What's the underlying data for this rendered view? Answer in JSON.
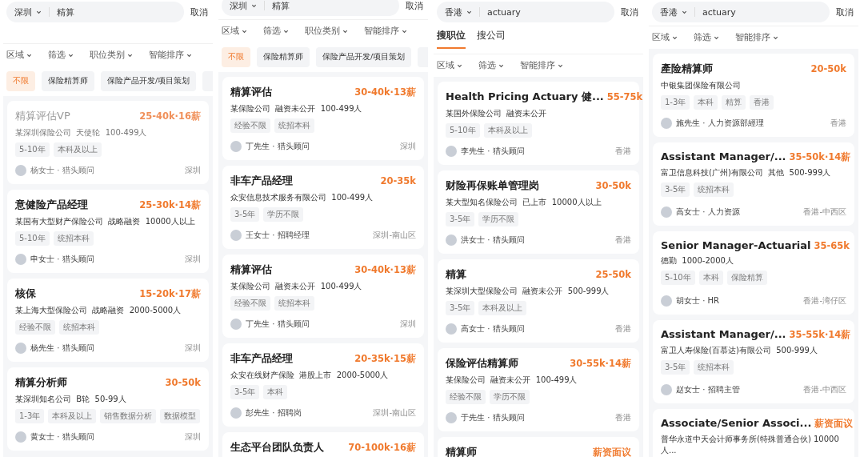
{
  "panels": [
    {
      "search": {
        "city": "深圳",
        "query": "精算"
      },
      "cancel": "取消",
      "filters": [
        "区域",
        "筛选",
        "职位类别",
        "智能排序"
      ],
      "chips": [
        {
          "label": "不限",
          "selected": true
        },
        {
          "label": "保险精算师",
          "selected": false
        },
        {
          "label": "保险产品开发/项目策划",
          "selected": false
        }
      ],
      "jobs": [
        {
          "title": "精算评估VP",
          "salary": "25-40k·16薪",
          "company": "某深圳保险公司  天使轮  100-499人",
          "tags": [
            "5-10年",
            "本科及以上"
          ],
          "recruiter": "杨女士 · 猎头顾问",
          "location": "深圳",
          "faded": true
        },
        {
          "title": "意健险产品经理",
          "salary": "25-30k·14薪",
          "company": "某国有大型财产保险公司  战略融资  10000人以上",
          "tags": [
            "5-10年",
            "统招本科"
          ],
          "recruiter": "申女士 · 猎头顾问",
          "location": "深圳",
          "faded": false
        },
        {
          "title": "核保",
          "salary": "15-20k·17薪",
          "company": "某上海大型保险公司  战略融资  2000-5000人",
          "tags": [
            "经验不限",
            "统招本科"
          ],
          "recruiter": "杨先生 · 猎头顾问",
          "location": "深圳",
          "faded": false
        },
        {
          "title": "精算分析师",
          "salary": "30-50k",
          "company": "某深圳知名公司  B轮  50-99人",
          "tags": [
            "1-3年",
            "本科及以上",
            "销售数据分析",
            "数据模型"
          ],
          "recruiter": "黄女士 · 猎头顾问",
          "location": "深圳",
          "faded": false
        }
      ]
    },
    {
      "search": {
        "city": "深圳",
        "query": "精算"
      },
      "cancel": "取消",
      "filters": [
        "区域",
        "筛选",
        "职位类别",
        "智能排序"
      ],
      "chips": [
        {
          "label": "不限",
          "selected": true
        },
        {
          "label": "保险精算师",
          "selected": false
        },
        {
          "label": "保险产品开发/项目策划",
          "selected": false
        }
      ],
      "jobs": [
        {
          "title": "精算评估",
          "salary": "30-40k·13薪",
          "company": "某保险公司  融资未公开  100-499人",
          "tags": [
            "经验不限",
            "统招本科"
          ],
          "recruiter": "丁先生 · 猎头顾问",
          "location": "深圳",
          "faded": false
        },
        {
          "title": "非车产品经理",
          "salary": "20-35k",
          "company": "众安信息技术服务有限公司  100-499人",
          "tags": [
            "3-5年",
            "学历不限"
          ],
          "recruiter": "王女士 · 招聘经理",
          "location": "深圳-南山区",
          "faded": false
        },
        {
          "title": "精算评估",
          "salary": "30-40k·13薪",
          "company": "某保险公司  融资未公开  100-499人",
          "tags": [
            "经验不限",
            "统招本科"
          ],
          "recruiter": "丁先生 · 猎头顾问",
          "location": "深圳",
          "faded": false
        },
        {
          "title": "非车产品经理",
          "salary": "20-35k·15薪",
          "company": "众安在线财产保险  港股上市  2000-5000人",
          "tags": [
            "3-5年",
            "本科"
          ],
          "recruiter": "彭先生 · 招聘岗",
          "location": "深圳-南山区",
          "faded": false
        },
        {
          "title": "生态平台团队负责人",
          "salary": "70-100k·16薪",
          "faded": false
        }
      ]
    },
    {
      "search": {
        "city": "香港",
        "query": "actuary"
      },
      "cancel": "取消",
      "tabs": [
        {
          "label": "搜职位",
          "selected": true
        },
        {
          "label": "搜公司",
          "selected": false
        }
      ],
      "filters": [
        "区域",
        "筛选",
        "智能排序"
      ],
      "jobs": [
        {
          "title": "Health Pricing Actuary 健...",
          "salary": "55-75k",
          "company": "某国外保险公司  融资未公开",
          "tags": [
            "5-10年",
            "本科及以上"
          ],
          "recruiter": "李先生 · 猎头顾问",
          "location": "香港",
          "faded": false
        },
        {
          "title": "财险再保账单管理岗",
          "salary": "30-50k",
          "company": "某大型知名保险公司  已上市  10000人以上",
          "tags": [
            "3-5年",
            "学历不限"
          ],
          "recruiter": "洪女士 · 猎头顾问",
          "location": "香港",
          "faded": false
        },
        {
          "title": "精算",
          "salary": "25-50k",
          "company": "某深圳大型保险公司  融资未公开  500-999人",
          "tags": [
            "3-5年",
            "本科及以上"
          ],
          "recruiter": "高女士 · 猎头顾问",
          "location": "香港",
          "faded": false
        },
        {
          "title": "保险评估精算师",
          "salary": "30-55k·14薪",
          "company": "某保险公司  融资未公开  100-499人",
          "tags": [
            "经验不限",
            "学历不限"
          ],
          "recruiter": "于先生 · 猎头顾问",
          "location": "香港",
          "faded": false
        },
        {
          "title": "精算师",
          "salary": "薪资面议",
          "faded": false
        }
      ]
    },
    {
      "search": {
        "city": "香港",
        "query": "actuary"
      },
      "cancel": "取消",
      "filters": [
        "区域",
        "筛选",
        "智能排序"
      ],
      "jobs": [
        {
          "title": "產险精算师",
          "salary": "20-50k",
          "company": "中银集团保险有限公司",
          "tags": [
            "1-3年",
            "本科",
            "精算",
            "香港"
          ],
          "recruiter": "施先生 · 人力资源部經理",
          "location": "香港",
          "faded": false
        },
        {
          "title": "Assistant Manager/...",
          "salary": "35-50k·14薪",
          "company": "富卫信息科技(广州)有限公司  其他  500-999人",
          "tags": [
            "3-5年",
            "统招本科"
          ],
          "recruiter": "高女士 · 人力资源",
          "location": "香港-中西区",
          "faded": false
        },
        {
          "title": "Senior Manager-Actuarial",
          "salary": "35-65k",
          "company": "德勤  1000-2000人",
          "tags": [
            "5-10年",
            "本科",
            "保险精算"
          ],
          "recruiter": "胡女士 · HR",
          "location": "香港-湾仔区",
          "faded": false
        },
        {
          "title": "Assistant Manager/...",
          "salary": "35-55k·14薪",
          "company": "富卫人寿保险(百慕达)有限公司  500-999人",
          "tags": [
            "3-5年",
            "统招本科"
          ],
          "recruiter": "赵女士 · 招聘主管",
          "location": "香港-中西区",
          "faded": false
        },
        {
          "title": "Associate/Senior Associ...",
          "salary": "薪资面议",
          "company": "普华永道中天会计师事务所(特殊普通合伙) 10000人...",
          "faded": false
        }
      ]
    }
  ]
}
